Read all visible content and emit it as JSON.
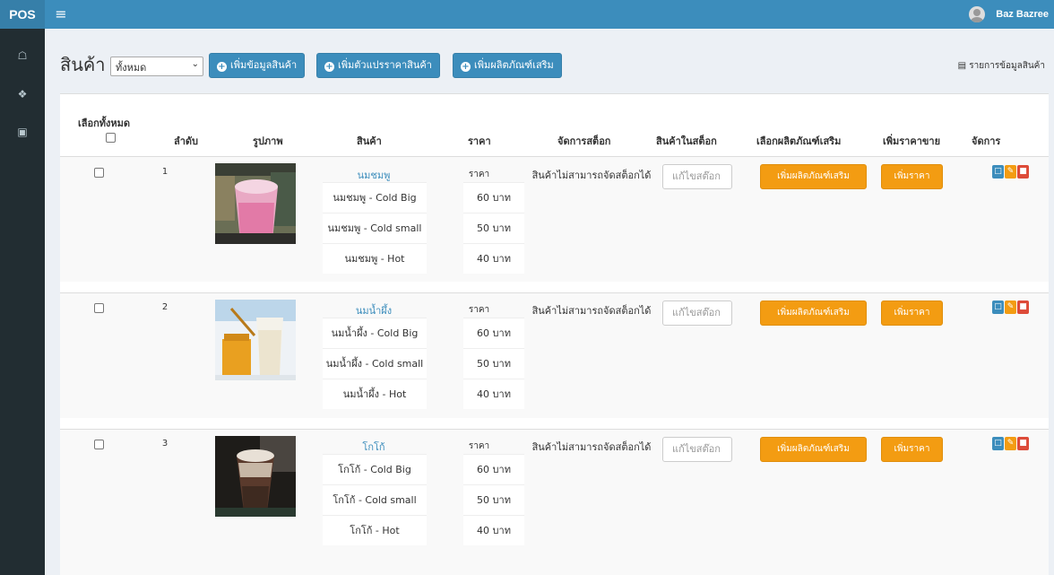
{
  "brand": "POS",
  "user_name": "Baz Bazree",
  "page_title": "สินค้า",
  "filter": {
    "selected": "ทั้งหมด"
  },
  "toolbar": {
    "add_product": "เพิ่มข้อมูลสินค้า",
    "add_price_variant": "เพิ่มตัวแปรราคาสินค้า",
    "add_addon": "เพิ่มผลิตภัณฑ์เสริม",
    "product_list": "รายการข้อมูลสินค้า"
  },
  "table": {
    "headers": {
      "select_all": "เลือกทั้งหมด",
      "index": "ลำดับ",
      "image": "รูปภาพ",
      "product": "สินค้า",
      "price": "ราคา",
      "manage_stock": "จัดการสต็อก",
      "in_stock": "สินค้าในสต็อก",
      "choose_addon": "เลือกผลิตภัณฑ์เสริม",
      "add_price": "เพิ่มราคาขาย",
      "manage": "จัดการ"
    },
    "rows": [
      {
        "index": "1",
        "name": "นมชมพู",
        "price_header": "ราคา",
        "stock_note": "สินค้าไม่สามารถจัดสต็อกได้",
        "stock_placeholder": "แก้ไขสต๊อก",
        "addon_button": "เพิ่มผลิตภัณฑ์เสริม",
        "price_button": "เพิ่มราคา",
        "variants": [
          {
            "name": "นมชมพู - Cold Big",
            "price": "60 บาท"
          },
          {
            "name": "นมชมพู - Cold small",
            "price": "50 บาท"
          },
          {
            "name": "นมชมพู - Hot",
            "price": "40 บาท"
          }
        ]
      },
      {
        "index": "2",
        "name": "นมน้ำผึ้ง",
        "price_header": "ราคา",
        "stock_note": "สินค้าไม่สามารถจัดสต็อกได้",
        "stock_placeholder": "แก้ไขสต๊อก",
        "addon_button": "เพิ่มผลิตภัณฑ์เสริม",
        "price_button": "เพิ่มราคา",
        "variants": [
          {
            "name": "นมน้ำผึ้ง - Cold Big",
            "price": "60 บาท"
          },
          {
            "name": "นมน้ำผึ้ง - Cold small",
            "price": "50 บาท"
          },
          {
            "name": "นมน้ำผึ้ง - Hot",
            "price": "40 บาท"
          }
        ]
      },
      {
        "index": "3",
        "name": "โกโก้",
        "price_header": "ราคา",
        "stock_note": "สินค้าไม่สามารถจัดสต็อกได้",
        "stock_placeholder": "แก้ไขสต๊อก",
        "addon_button": "เพิ่มผลิตภัณฑ์เสริม",
        "price_button": "เพิ่มราคา",
        "variants": [
          {
            "name": "โกโก้ - Cold Big",
            "price": "60 บาท"
          },
          {
            "name": "โกโก้ - Cold small",
            "price": "50 บาท"
          },
          {
            "name": "โกโก้ - Hot",
            "price": "40 บาท"
          }
        ]
      }
    ]
  },
  "colors": {
    "primary": "#3c8dbc",
    "sidebar": "#222d32",
    "warning": "#f39c12",
    "danger": "#dd4b39"
  },
  "icons": {
    "menu": "hamburger-icon",
    "home": "home-icon",
    "products": "fork-knife-icon",
    "cash": "money-icon"
  }
}
